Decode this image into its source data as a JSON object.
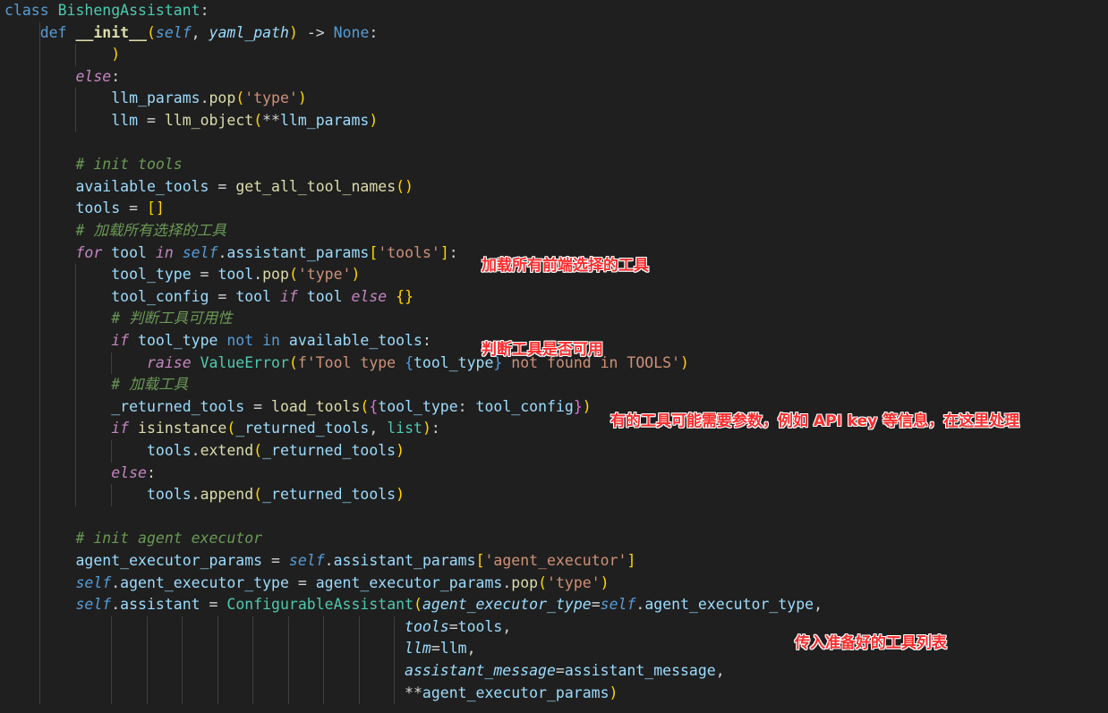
{
  "editor": {
    "colors": {
      "background": "#1f1f1f",
      "keyword": "#569cd6",
      "control": "#c586c0",
      "class": "#4ec9b0",
      "function": "#dcdcaa",
      "variable": "#9cdcfe",
      "string": "#ce9178",
      "comment": "#6a9955",
      "annotation": "#ff2b2b"
    },
    "lines": [
      {
        "indent": 0,
        "tokens": [
          [
            "class ",
            "kw"
          ],
          [
            "BishengAssistant",
            "cls"
          ],
          [
            ":",
            "op"
          ]
        ]
      },
      {
        "indent": 1,
        "tokens": [
          [
            "def ",
            "kw"
          ],
          [
            "__init__",
            "fn bold"
          ],
          [
            "(",
            "p1"
          ],
          [
            "self",
            "self"
          ],
          [
            ", ",
            "op"
          ],
          [
            "yaml_path",
            "param"
          ],
          [
            ")",
            "p1"
          ],
          [
            " -> ",
            "op"
          ],
          [
            "None",
            "kw"
          ],
          [
            ":",
            "op"
          ]
        ]
      },
      {
        "indent": 3,
        "tokens": [
          [
            ")",
            "p1"
          ]
        ]
      },
      {
        "indent": 2,
        "tokens": [
          [
            "else",
            "ctrl ital"
          ],
          [
            ":",
            "op"
          ]
        ]
      },
      {
        "indent": 3,
        "tokens": [
          [
            "llm_params",
            "var"
          ],
          [
            ".",
            "op"
          ],
          [
            "pop",
            "fn"
          ],
          [
            "(",
            "p1"
          ],
          [
            "'type'",
            "str"
          ],
          [
            ")",
            "p1"
          ]
        ]
      },
      {
        "indent": 3,
        "tokens": [
          [
            "llm",
            "var"
          ],
          [
            " = ",
            "op"
          ],
          [
            "llm_object",
            "fn"
          ],
          [
            "(",
            "p1"
          ],
          [
            "**",
            "op"
          ],
          [
            "llm_params",
            "var"
          ],
          [
            ")",
            "p1"
          ]
        ]
      },
      {
        "indent": 0,
        "tokens": []
      },
      {
        "indent": 2,
        "tokens": [
          [
            "# init tools",
            "cmt"
          ]
        ]
      },
      {
        "indent": 2,
        "tokens": [
          [
            "available_tools",
            "var"
          ],
          [
            " = ",
            "op"
          ],
          [
            "get_all_tool_names",
            "fn"
          ],
          [
            "()",
            "p1"
          ]
        ]
      },
      {
        "indent": 2,
        "tokens": [
          [
            "tools",
            "var"
          ],
          [
            " = ",
            "op"
          ],
          [
            "[]",
            "p1"
          ]
        ]
      },
      {
        "indent": 2,
        "tokens": [
          [
            "# 加载所有选择的工具",
            "cmt"
          ]
        ]
      },
      {
        "indent": 2,
        "tokens": [
          [
            "for ",
            "ctrl ital"
          ],
          [
            "tool",
            "var"
          ],
          [
            " in ",
            "ctrl ital"
          ],
          [
            "self",
            "self"
          ],
          [
            ".",
            "op"
          ],
          [
            "assistant_params",
            "var"
          ],
          [
            "[",
            "p1"
          ],
          [
            "'tools'",
            "str"
          ],
          [
            "]",
            "p1"
          ],
          [
            ":",
            "op"
          ]
        ]
      },
      {
        "indent": 3,
        "tokens": [
          [
            "tool_type",
            "var"
          ],
          [
            " = ",
            "op"
          ],
          [
            "tool",
            "var"
          ],
          [
            ".",
            "op"
          ],
          [
            "pop",
            "fn"
          ],
          [
            "(",
            "p1"
          ],
          [
            "'type'",
            "str"
          ],
          [
            ")",
            "p1"
          ]
        ]
      },
      {
        "indent": 3,
        "tokens": [
          [
            "tool_config",
            "var"
          ],
          [
            " = ",
            "op"
          ],
          [
            "tool",
            "var"
          ],
          [
            " if ",
            "ctrl ital"
          ],
          [
            "tool",
            "var"
          ],
          [
            " else ",
            "ctrl ital"
          ],
          [
            "{}",
            "p1"
          ]
        ]
      },
      {
        "indent": 3,
        "tokens": [
          [
            "# 判断工具可用性",
            "cmt"
          ]
        ]
      },
      {
        "indent": 3,
        "tokens": [
          [
            "if ",
            "ctrl ital"
          ],
          [
            "tool_type",
            "var"
          ],
          [
            " not in ",
            "kw"
          ],
          [
            "available_tools",
            "var"
          ],
          [
            ":",
            "op"
          ]
        ]
      },
      {
        "indent": 4,
        "tokens": [
          [
            "raise ",
            "ctrl ital"
          ],
          [
            "ValueError",
            "cls"
          ],
          [
            "(",
            "p1"
          ],
          [
            "f'Tool type ",
            "str"
          ],
          [
            "{",
            "kw"
          ],
          [
            "tool_type",
            "var"
          ],
          [
            "}",
            "kw"
          ],
          [
            " not found in TOOLS'",
            "str"
          ],
          [
            ")",
            "p1"
          ]
        ]
      },
      {
        "indent": 3,
        "tokens": [
          [
            "# 加载工具",
            "cmt"
          ]
        ]
      },
      {
        "indent": 3,
        "tokens": [
          [
            "_returned_tools",
            "var"
          ],
          [
            " = ",
            "op"
          ],
          [
            "load_tools",
            "fn"
          ],
          [
            "(",
            "p1"
          ],
          [
            "{",
            "p2"
          ],
          [
            "tool_type",
            "var"
          ],
          [
            ": ",
            "op"
          ],
          [
            "tool_config",
            "var"
          ],
          [
            "}",
            "p2"
          ],
          [
            ")",
            "p1"
          ]
        ]
      },
      {
        "indent": 3,
        "tokens": [
          [
            "if ",
            "ctrl ital"
          ],
          [
            "isinstance",
            "fn"
          ],
          [
            "(",
            "p1"
          ],
          [
            "_returned_tools",
            "var"
          ],
          [
            ", ",
            "op"
          ],
          [
            "list",
            "cls"
          ],
          [
            ")",
            "p1"
          ],
          [
            ":",
            "op"
          ]
        ]
      },
      {
        "indent": 4,
        "tokens": [
          [
            "tools",
            "var"
          ],
          [
            ".",
            "op"
          ],
          [
            "extend",
            "fn"
          ],
          [
            "(",
            "p1"
          ],
          [
            "_returned_tools",
            "var"
          ],
          [
            ")",
            "p1"
          ]
        ]
      },
      {
        "indent": 3,
        "tokens": [
          [
            "else",
            "ctrl ital"
          ],
          [
            ":",
            "op"
          ]
        ]
      },
      {
        "indent": 4,
        "tokens": [
          [
            "tools",
            "var"
          ],
          [
            ".",
            "op"
          ],
          [
            "append",
            "fn"
          ],
          [
            "(",
            "p1"
          ],
          [
            "_returned_tools",
            "var"
          ],
          [
            ")",
            "p1"
          ]
        ]
      },
      {
        "indent": 0,
        "tokens": []
      },
      {
        "indent": 2,
        "tokens": [
          [
            "# init agent executor",
            "cmt"
          ]
        ]
      },
      {
        "indent": 2,
        "tokens": [
          [
            "agent_executor_params",
            "var"
          ],
          [
            " = ",
            "op"
          ],
          [
            "self",
            "self"
          ],
          [
            ".",
            "op"
          ],
          [
            "assistant_params",
            "var"
          ],
          [
            "[",
            "p1"
          ],
          [
            "'agent_executor'",
            "str"
          ],
          [
            "]",
            "p1"
          ]
        ]
      },
      {
        "indent": 2,
        "tokens": [
          [
            "self",
            "self"
          ],
          [
            ".",
            "op"
          ],
          [
            "agent_executor_type",
            "var"
          ],
          [
            " = ",
            "op"
          ],
          [
            "agent_executor_params",
            "var"
          ],
          [
            ".",
            "op"
          ],
          [
            "pop",
            "fn"
          ],
          [
            "(",
            "p1"
          ],
          [
            "'type'",
            "str"
          ],
          [
            ")",
            "p1"
          ]
        ]
      },
      {
        "indent": 2,
        "tokens": [
          [
            "self",
            "self"
          ],
          [
            ".",
            "op"
          ],
          [
            "assistant",
            "var"
          ],
          [
            " = ",
            "op"
          ],
          [
            "ConfigurableAssistant",
            "cls"
          ],
          [
            "(",
            "p1"
          ],
          [
            "agent_executor_type",
            "param"
          ],
          [
            "=",
            "op"
          ],
          [
            "self",
            "self"
          ],
          [
            ".",
            "op"
          ],
          [
            "agent_executor_type",
            "var"
          ],
          [
            ",",
            "op"
          ]
        ]
      },
      {
        "indent": 0,
        "pad": "                                             ",
        "tokens": [
          [
            "tools",
            "param"
          ],
          [
            "=",
            "op"
          ],
          [
            "tools",
            "var"
          ],
          [
            ",",
            "op"
          ]
        ]
      },
      {
        "indent": 0,
        "pad": "                                             ",
        "tokens": [
          [
            "llm",
            "param"
          ],
          [
            "=",
            "op"
          ],
          [
            "llm",
            "var"
          ],
          [
            ",",
            "op"
          ]
        ]
      },
      {
        "indent": 0,
        "pad": "                                             ",
        "tokens": [
          [
            "assistant_message",
            "param"
          ],
          [
            "=",
            "op"
          ],
          [
            "assistant_message",
            "var"
          ],
          [
            ",",
            "op"
          ]
        ]
      },
      {
        "indent": 0,
        "pad": "                                             ",
        "tokens": [
          [
            "**",
            "op"
          ],
          [
            "agent_executor_params",
            "var"
          ],
          [
            ")",
            "p1"
          ]
        ]
      }
    ]
  },
  "annotations": [
    {
      "text": "加载所有前端选择的工具"
    },
    {
      "text": "判断工具是否可用"
    },
    {
      "text": "有的工具可能需要参数，例如 API key 等信息，在这里处理"
    },
    {
      "text": "传入准备好的工具列表"
    }
  ]
}
